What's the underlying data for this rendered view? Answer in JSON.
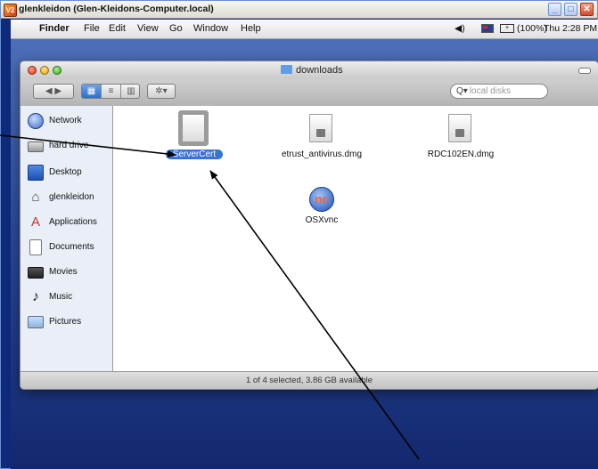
{
  "vnc_window": {
    "title": "glenkleidon (Glen-Kleidons-Computer.local)",
    "app_icon": "V2",
    "controls": [
      "minimize",
      "maximize",
      "close"
    ]
  },
  "menubar": {
    "apple_icon": "apple-icon",
    "app_name": "Finder",
    "menus": [
      "File",
      "Edit",
      "View",
      "Go",
      "Window",
      "Help"
    ],
    "battery": "(100%)",
    "clock": "Thu 2:28 PM"
  },
  "finder": {
    "title": "downloads",
    "search_placeholder": "local disks",
    "sidebar": [
      {
        "label": "Network",
        "icon": "globe-icon"
      },
      {
        "label": "hard drive",
        "icon": "hard-drive-icon"
      },
      {
        "label": "Desktop",
        "icon": "desktop-icon"
      },
      {
        "label": "glenkleidon",
        "icon": "home-icon"
      },
      {
        "label": "Applications",
        "icon": "applications-icon"
      },
      {
        "label": "Documents",
        "icon": "documents-icon"
      },
      {
        "label": "Movies",
        "icon": "movies-icon"
      },
      {
        "label": "Music",
        "icon": "music-icon"
      },
      {
        "label": "Pictures",
        "icon": "pictures-icon"
      }
    ],
    "files": [
      {
        "name": "ServerCert",
        "icon": "document-icon",
        "selected": true
      },
      {
        "name": "etrust_antivirus.dmg",
        "icon": "disk-image-icon",
        "selected": false
      },
      {
        "name": "RDC102EN.dmg",
        "icon": "disk-image-icon",
        "selected": false
      },
      {
        "name": "OSXvnc",
        "icon": "vnc-app-icon",
        "selected": false
      }
    ],
    "vnc_logo_text": "nc",
    "status": "1 of 4 selected, 3.86 GB available"
  },
  "colors": {
    "selection": "#3873d6",
    "desktop": "#2c4a9a"
  }
}
